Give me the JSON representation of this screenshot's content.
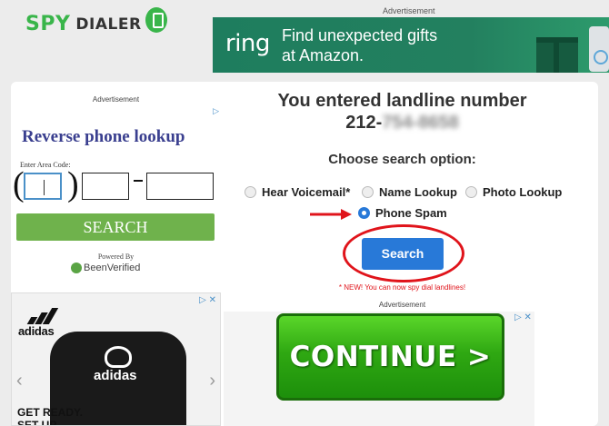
{
  "header": {
    "logo_spy": "SPY",
    "logo_dialer": "DIALER",
    "ad_label": "Advertisement",
    "ring_ad": {
      "brand": "ring",
      "line1": "Find unexpected gifts",
      "line2": "at Amazon."
    }
  },
  "lookup_widget": {
    "ad_label": "Advertisement",
    "title": "Reverse phone lookup",
    "area_code_label": "Enter Area Code:",
    "search_label": "SEARCH",
    "powered_by": "Powered By",
    "brand": "BeenVerified"
  },
  "adidas_ad": {
    "brand": "adidas",
    "sweater_brand": "adidas",
    "cta_line1": "GET READY.",
    "cta_line2": "SET UP."
  },
  "main": {
    "headline_line1": "You entered landline number",
    "phone_prefix": "212-",
    "phone_hidden": "754-8658",
    "choose_label": "Choose search option:",
    "options": [
      {
        "label": "Hear Voicemail*",
        "checked": false
      },
      {
        "label": "Name Lookup",
        "checked": false
      },
      {
        "label": "Photo Lookup",
        "checked": false
      },
      {
        "label": "Phone Spam",
        "checked": true
      }
    ],
    "search_button": "Search",
    "new_note": "* NEW! You can now spy dial landlines!",
    "ad_label": "Advertisement",
    "continue_label": "CONTINUE >"
  },
  "colors": {
    "brand_green": "#39b54a",
    "primary_blue": "#2879d8",
    "highlight_red": "#e0141b"
  }
}
